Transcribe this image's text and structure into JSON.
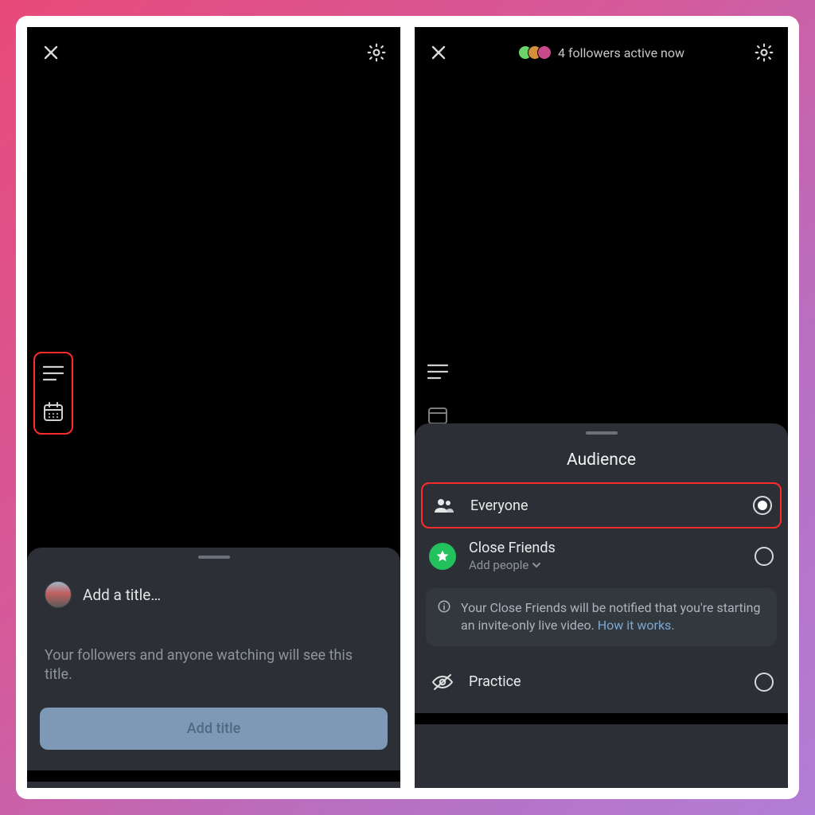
{
  "left": {
    "title_placeholder": "Add a title…",
    "description": "Your followers and anyone watching will see this title.",
    "button_label": "Add title"
  },
  "right": {
    "status_text": "4 followers active now",
    "audience": {
      "heading": "Audience",
      "options": [
        {
          "label": "Everyone",
          "selected": true
        },
        {
          "label": "Close Friends",
          "sub": "Add people",
          "selected": false
        },
        {
          "label": "Practice",
          "selected": false
        }
      ],
      "info_text": "Your Close Friends will be notified that you're starting an invite-only live video. ",
      "info_link": "How it works"
    }
  }
}
